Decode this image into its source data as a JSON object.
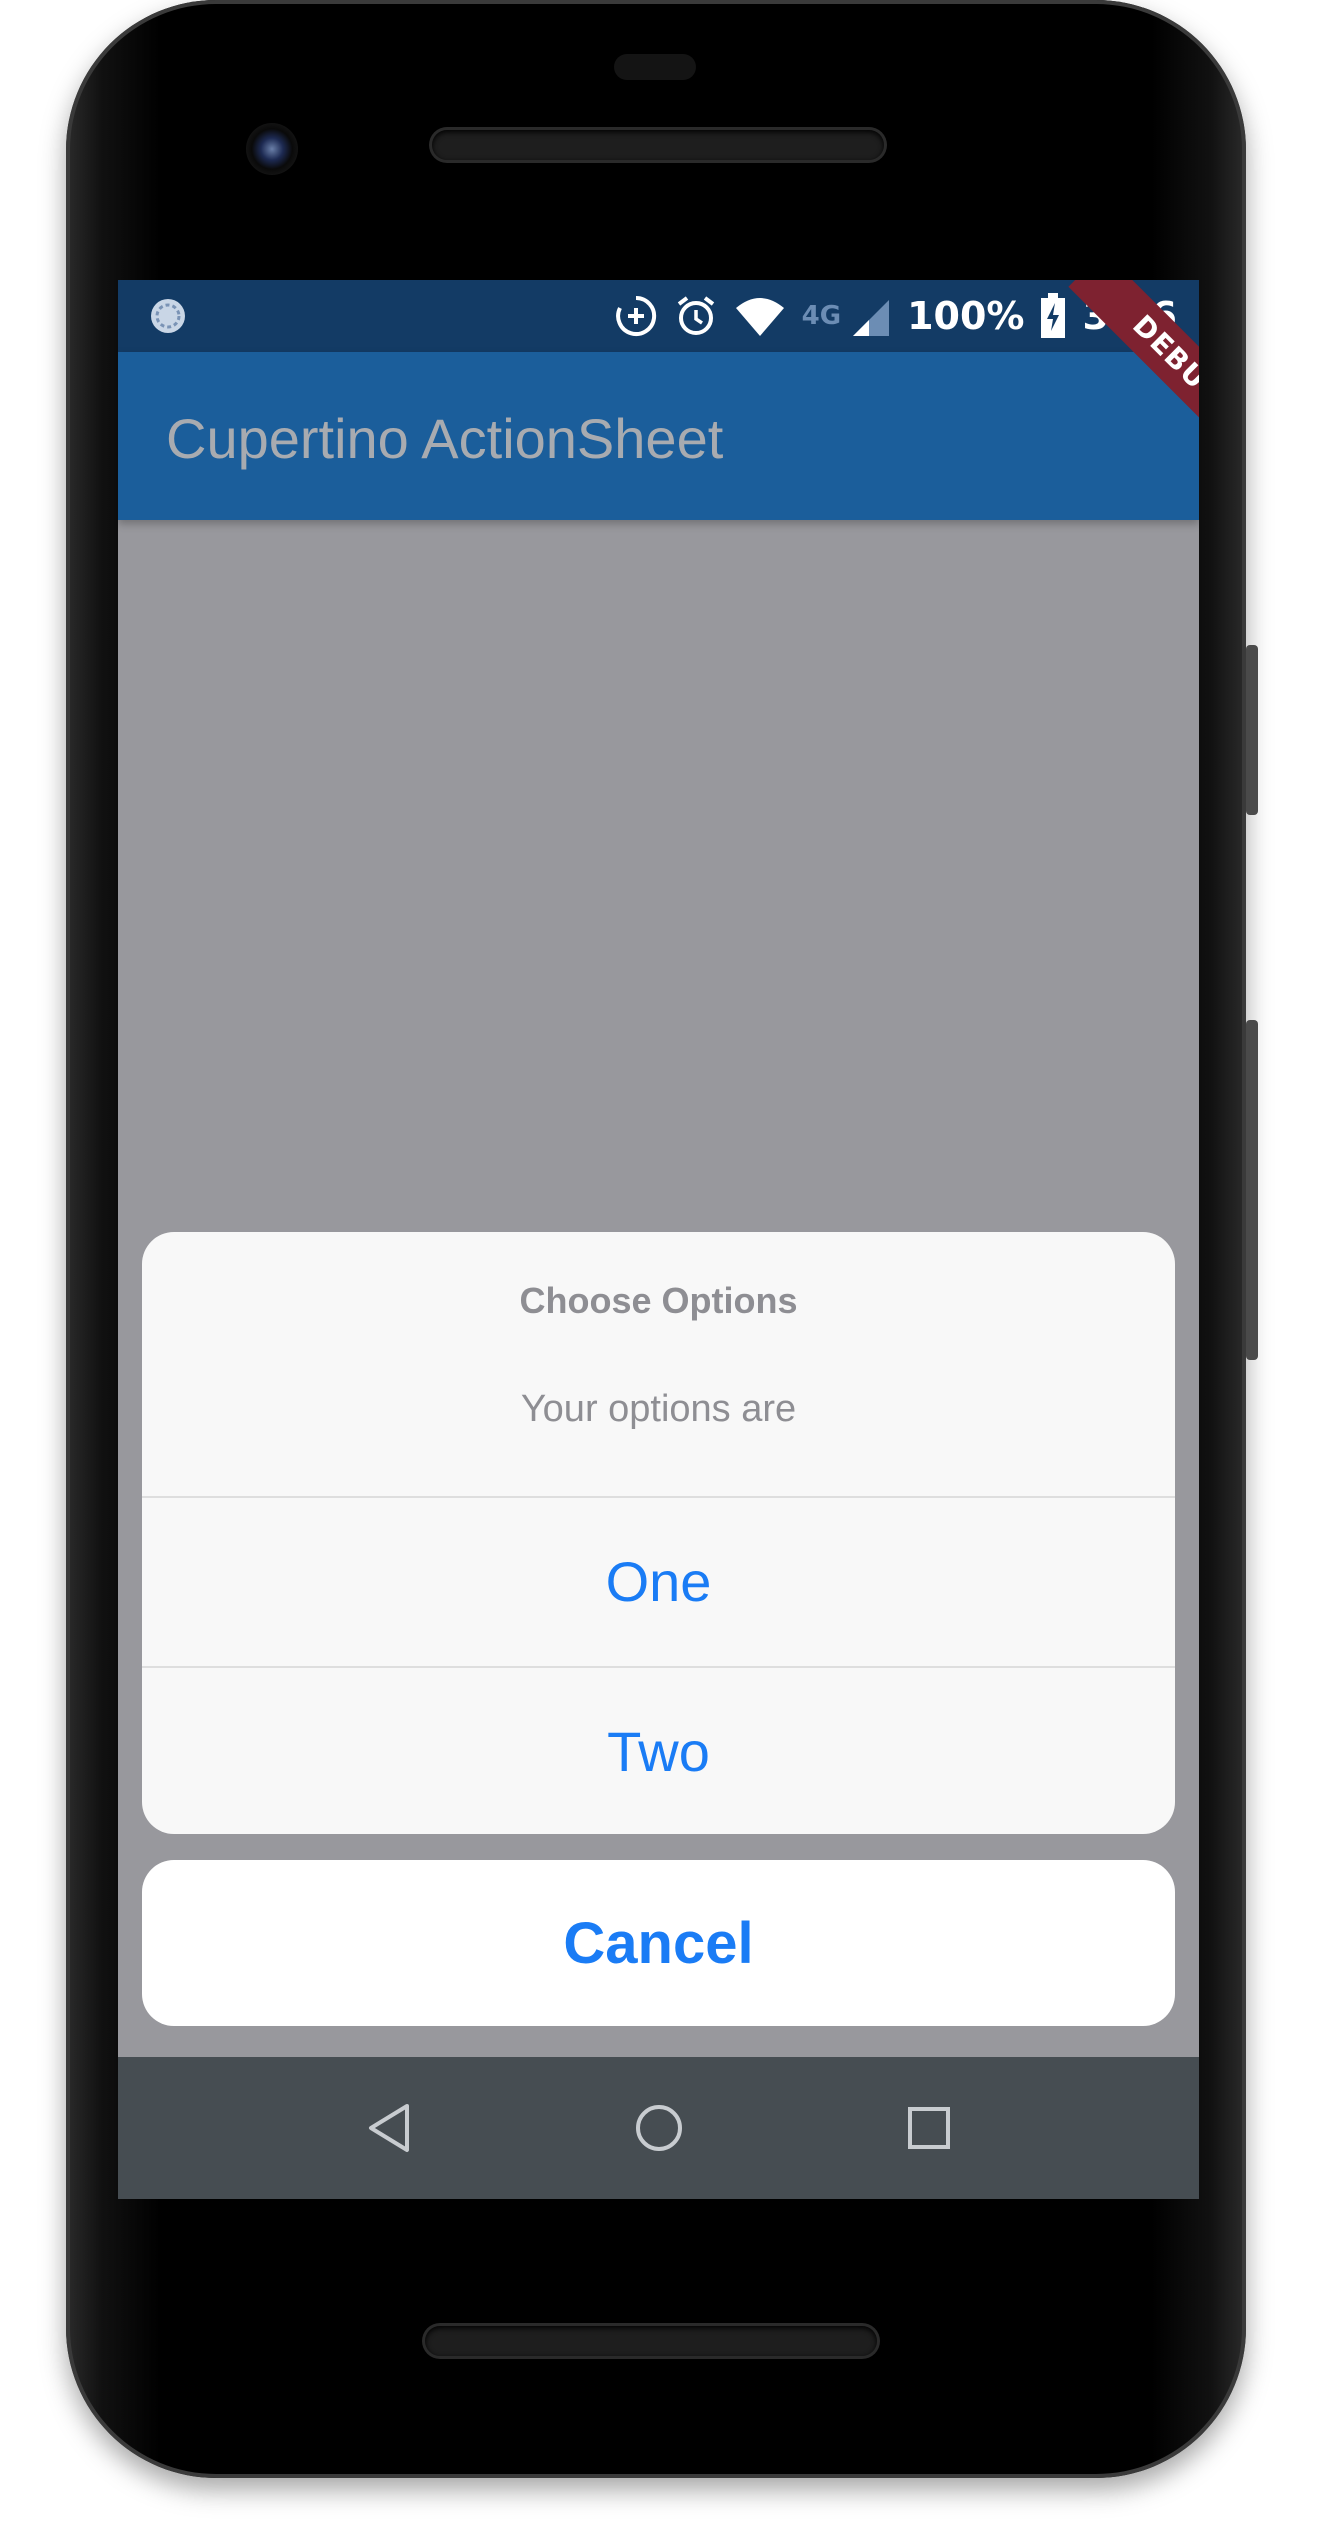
{
  "status_bar": {
    "network_label": "4G",
    "battery": "100%",
    "time": "3:46",
    "left_icon": "sync-circle-icon",
    "right_icons": [
      "data-saver-icon",
      "alarm-icon",
      "wifi-icon",
      "signal-icon",
      "battery-charging-icon"
    ]
  },
  "debug_banner": "DEBUG",
  "app_bar": {
    "title": "Cupertino ActionSheet",
    "color": "#1b5e9b"
  },
  "action_sheet": {
    "title": "Choose Options",
    "message": "Your options are",
    "actions": [
      {
        "label": "One"
      },
      {
        "label": "Two"
      }
    ],
    "cancel_label": "Cancel",
    "accent_color": "#1a7cf5"
  },
  "nav_bar": {
    "buttons": [
      "back-icon",
      "home-icon",
      "recents-icon"
    ]
  }
}
